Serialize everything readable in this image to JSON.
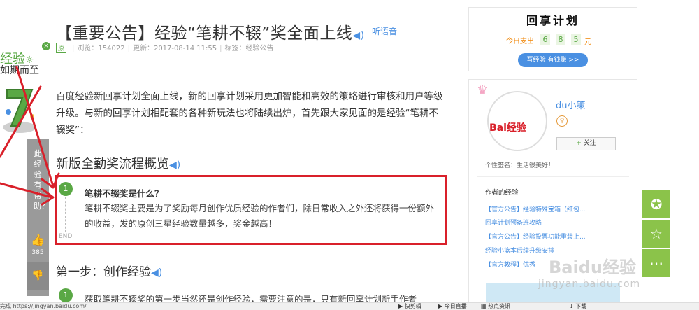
{
  "article": {
    "title": "【重要公告】经验“笔耕不辍”奖全面上线",
    "speaker_icon": "speaker-icon",
    "listen_label": "听语音",
    "original_tag": "原",
    "views": "浏览：154022",
    "updated": "更新：2017-08-14 11:55",
    "tags": "标签：经验公告",
    "intro": "百度经验新回享计划全面上线，新的回享计划采用更加智能和高效的策略进行审核和用户等级升级。与新的回享计划相配套的各种新玩法也将陆续出炉，首先跟大家见面的是经验“笔耕不辍奖”：",
    "section1_title": "新版全勤奖流程概览",
    "step1": {
      "number": "1",
      "title": "笔耕不辍奖是什么？",
      "text": "笔耕不辍奖主要是为了奖励每月创作优质经验的作者们，除日常收入之外还将获得一份额外的收益，发的原创三星经验数量越多，奖金越高！",
      "end_label": "END"
    },
    "section2_title": "第一步：创作经验",
    "step2": {
      "number": "1",
      "text": "获取笔耕不辍奖的第一步当然还是创作经验，需要注意的是，只有新回享计划新手作者"
    }
  },
  "left_overlay": {
    "tag": "经验",
    "bulb_icon": "lightbulb-icon",
    "subtitle": "如期而至",
    "close_icon": "close-icon",
    "helpful_text": "此经验有帮助？",
    "like_count": "385",
    "thumb_up_icon": "thumb-up-icon",
    "thumb_down_icon": "thumb-down-icon"
  },
  "sidebar": {
    "plan_title": "回享计划",
    "payout_label": "今日支出",
    "payout_digits": [
      "6",
      "8",
      "5"
    ],
    "payout_unit": "元",
    "write_button": "写经验 有钱赚 >>",
    "author_name": "du小策",
    "avatar_logo": "Bai经验",
    "follow_button": "关注",
    "signature": "个性签名：生活很美好！",
    "author_exp_title": "作者的经验",
    "exp_links": [
      "【官方公告】经验特殊宝箱（红包...",
      "回享计划预备班攻略",
      "【官方公告】经验投票功能重装上...",
      "经验小篮本后续升级安排",
      "【官方教程】优秀"
    ]
  },
  "float_tools": {
    "award_icon": "award-icon",
    "star_icon": "star-icon",
    "more_icon": "more-icon"
  },
  "watermark": {
    "main": "Baidu经验",
    "url": "jingyan.baidu.com"
  },
  "status_bar": {
    "left": "完成 https://jingyan.baidu.com/",
    "clip": "快剪辑",
    "live": "今日直播",
    "news": "热点资讯",
    "download": "下载"
  },
  "colors": {
    "accent_green": "#5aa845",
    "link_blue": "#4a90e2",
    "annotation_red": "#d9202a",
    "payout_orange": "#f08300"
  }
}
